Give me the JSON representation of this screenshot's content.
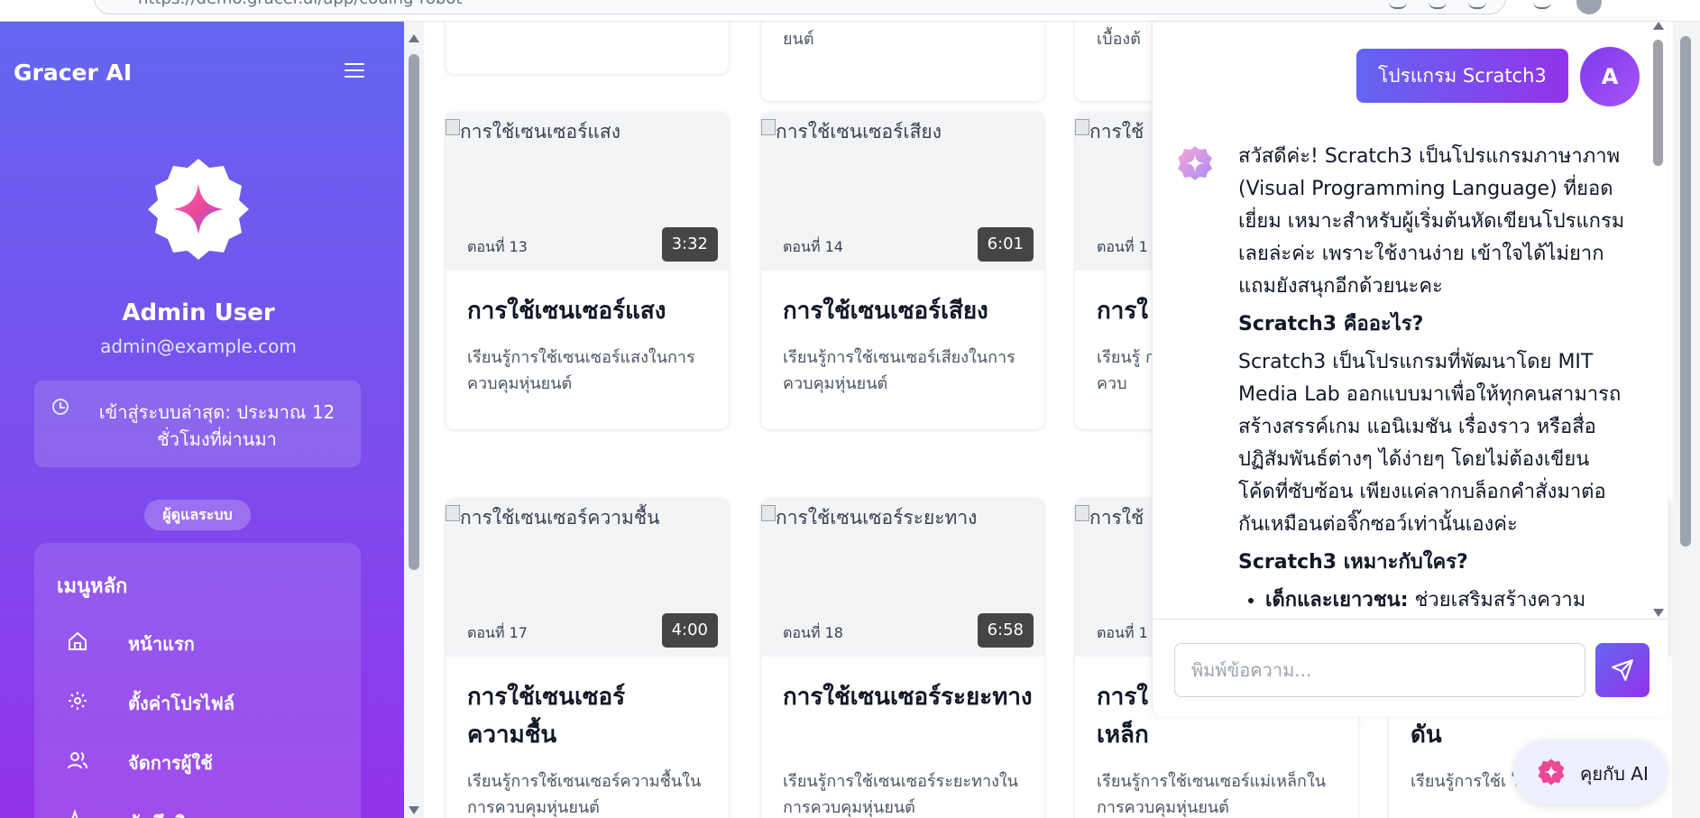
{
  "browser": {
    "url": "https://demo.gracer.ai/app/coding-robot"
  },
  "sidebar": {
    "title": "Gracer AI",
    "user_name": "Admin User",
    "user_email": "admin@example.com",
    "last_login": "เข้าสู่ระบบล่าสุด: ประมาณ 12 ชั่วโมงที่ผ่านมา",
    "role_badge": "ผู้ดูแลระบบ",
    "menu_title": "เมนูหลัก",
    "items": [
      {
        "label": "หน้าแรก",
        "icon": "home-icon"
      },
      {
        "label": "ตั้งค่าโปรไฟล์",
        "icon": "gear-icon"
      },
      {
        "label": "จัดการผู้ใช้",
        "icon": "users-icon"
      },
      {
        "label": "บันทึกกิจกรรม",
        "icon": "activity-icon"
      }
    ]
  },
  "top_partial": {
    "card1": "",
    "card2": "ยนต์",
    "card3": "เบื้องต้"
  },
  "cards": [
    {
      "thumb_alt": "การใช้เซนเซอร์แสง",
      "episode": "ตอนที่ 13",
      "duration": "3:32",
      "title": "การใช้เซนเซอร์แสง",
      "desc": "เรียนรู้การใช้เซนเซอร์แสงในการควบคุมหุ่นยนต์"
    },
    {
      "thumb_alt": "การใช้เซนเซอร์เสียง",
      "episode": "ตอนที่ 14",
      "duration": "6:01",
      "title": "การใช้เซนเซอร์เสียง",
      "desc": "เรียนรู้การใช้เซนเซอร์เสียงในการควบคุมหุ่นยนต์"
    },
    {
      "thumb_alt": "การใช้",
      "episode": "ตอนที่ 1",
      "duration": "",
      "title": "การใ",
      "desc": "เรียนรู้ การควบ"
    },
    {
      "thumb_alt": "การใช้เซนเซอร์ความชื้น",
      "episode": "ตอนที่ 17",
      "duration": "4:00",
      "title": "การใช้เซนเซอร์ความชื้น",
      "desc": "เรียนรู้การใช้เซนเซอร์ความชื้นในการควบคุมหุ่นยนต์"
    },
    {
      "thumb_alt": "การใช้เซนเซอร์ระยะทาง",
      "episode": "ตอนที่ 18",
      "duration": "6:58",
      "title": "การใช้เซนเซอร์ระยะทาง",
      "desc": "เรียนรู้การใช้เซนเซอร์ระยะทางในการควบคุมหุ่นยนต์"
    },
    {
      "thumb_alt": "การใช้",
      "episode": "ตอนที่ 1",
      "duration": "",
      "title": "การใ เหล็ก",
      "desc": "เรียนรู้การใช้เซนเซอร์แม่เหล็กในการควบคุมหุ่นยนต์"
    },
    {
      "thumb_alt": "",
      "episode": "",
      "duration": "",
      "title": "ดัน",
      "desc": "เรียนรู้การใช้เ ในการควบคุมหุ่นยนต์"
    }
  ],
  "chat": {
    "user_message": "โปรแกรม Scratch3",
    "user_initial": "A",
    "bot_intro": "สวัสดีค่ะ! Scratch3 เป็นโปรแกรมภาษาภาพ (Visual Programming Language) ที่ยอดเยี่ยม เหมาะสำหรับผู้เริ่มต้นหัดเขียนโปรแกรมเลยล่ะค่ะ เพราะใช้งานง่าย เข้าใจได้ไม่ยาก แถมยังสนุกอีกด้วยนะคะ",
    "heading1": "Scratch3 คืออะไร?",
    "para1": "Scratch3 เป็นโปรแกรมที่พัฒนาโดย MIT Media Lab ออกแบบมาเพื่อให้ทุกคนสามารถสร้างสรรค์เกม แอนิเมชัน เรื่องราว หรือสื่อปฏิสัมพันธ์ต่างๆ ได้ง่ายๆ โดยไม่ต้องเขียนโค้ดที่ซับซ้อน เพียงแค่ลากบล็อกคำสั่งมาต่อกันเหมือนต่อจิ๊กซอว์เท่านั้นเองค่ะ",
    "heading2": "Scratch3 เหมาะกับใคร?",
    "bullet1_bold": "เด็กและเยาวชน:",
    "bullet1_text": " ช่วยเสริมสร้างความ",
    "input_placeholder": "พิมพ์ข้อความ...",
    "fab_label": "คุยกับ AI"
  }
}
